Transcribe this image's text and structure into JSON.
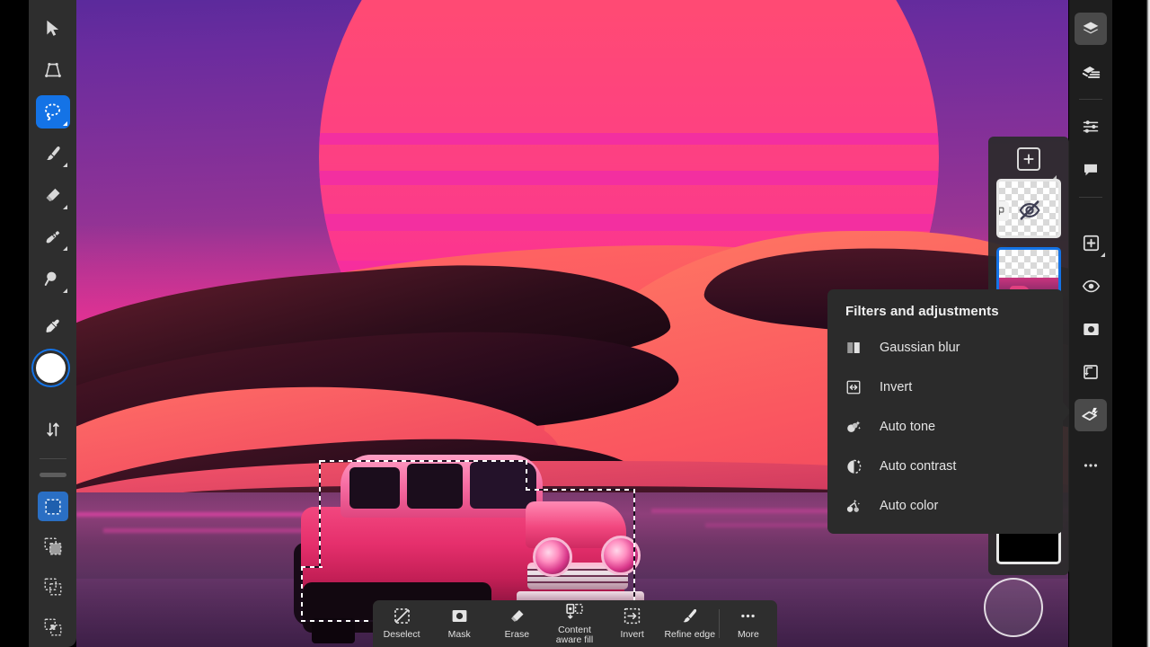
{
  "app": {
    "title": "Photo Editor",
    "accent": "#1473e6",
    "panel_bg": "#2e2e2e"
  },
  "left_toolbar": {
    "tools": [
      {
        "name": "move-tool",
        "label": "Move",
        "icon": "cursor-arrow-icon",
        "active": false,
        "has_flyout": false
      },
      {
        "name": "transform-tool",
        "label": "Transform",
        "icon": "transform-icon",
        "active": false,
        "has_flyout": false
      },
      {
        "name": "lasso-tool",
        "label": "Lasso select",
        "icon": "lasso-icon",
        "active": true,
        "has_flyout": true
      },
      {
        "name": "brush-tool",
        "label": "Brush",
        "icon": "paintbrush-icon",
        "active": false,
        "has_flyout": true
      },
      {
        "name": "eraser-tool",
        "label": "Eraser",
        "icon": "eraser-icon",
        "active": false,
        "has_flyout": true
      },
      {
        "name": "healing-tool",
        "label": "Spot heal",
        "icon": "healing-brush-icon",
        "active": false,
        "has_flyout": true
      },
      {
        "name": "zoom-tool",
        "label": "Zoom",
        "icon": "magnifier-icon",
        "active": false,
        "has_flyout": true
      },
      {
        "name": "eyedropper-tool",
        "label": "Eyedropper",
        "icon": "eyedropper-icon",
        "active": false,
        "has_flyout": false
      }
    ],
    "colors": {
      "foreground": "#ffffff",
      "background": "#000000",
      "swap_label": "Swap colors",
      "swap_icon": "swap-arrows-icon"
    },
    "selection_modes": [
      {
        "name": "new-selection",
        "label": "New selection",
        "icon": "marquee-new-icon",
        "active": true
      },
      {
        "name": "add-to-selection",
        "label": "Add to selection",
        "icon": "marquee-add-icon",
        "active": false
      },
      {
        "name": "subtract-selection",
        "label": "Subtract from selection",
        "icon": "marquee-subtract-icon",
        "active": false
      },
      {
        "name": "intersect-selection",
        "label": "Intersect selection",
        "icon": "marquee-intersect-icon",
        "active": false
      }
    ]
  },
  "right_rail": {
    "items": [
      {
        "name": "layers-panel-button",
        "label": "Layers",
        "icon": "layers-icon",
        "active": true,
        "has_flyout": false
      },
      {
        "name": "layer-stack-button",
        "label": "Layer properties",
        "icon": "layer-stack-icon",
        "active": false,
        "has_flyout": false
      },
      {
        "name": "adjustments-button",
        "label": "Adjustments",
        "icon": "sliders-icon",
        "active": false,
        "has_flyout": false
      },
      {
        "name": "comments-button",
        "label": "Comments",
        "icon": "comment-bubble-icon",
        "active": false,
        "has_flyout": false
      },
      {
        "name": "add-layer-button",
        "label": "Add layer",
        "icon": "add-square-icon",
        "active": false,
        "has_flyout": true
      },
      {
        "name": "visibility-button",
        "label": "Show / hide layer",
        "icon": "eye-icon",
        "active": false,
        "has_flyout": false
      },
      {
        "name": "mask-button",
        "label": "Add mask",
        "icon": "mask-icon",
        "active": false,
        "has_flyout": false
      },
      {
        "name": "clipping-mask-button",
        "label": "Clipping mask",
        "icon": "clipping-mask-icon",
        "active": false,
        "has_flyout": false
      },
      {
        "name": "filters-adjustments-button",
        "label": "Filters and adjustments",
        "icon": "magic-layer-icon",
        "active": true,
        "has_flyout": false
      },
      {
        "name": "more-options-button",
        "label": "More",
        "icon": "ellipsis-icon",
        "active": false,
        "has_flyout": false
      }
    ]
  },
  "layers_panel": {
    "add_layer": {
      "label": "Add layer",
      "icon": "plus-square-icon"
    },
    "layers": [
      {
        "name": "layer-hidden",
        "label": "Hidden layer",
        "selected": false,
        "hidden": true,
        "thumb": "transparent",
        "badge_icon": "link-layers-icon"
      },
      {
        "name": "layer-selected",
        "label": "Selected layer",
        "selected": true,
        "hidden": false,
        "thumb": "artwork",
        "badge_icon": ""
      },
      {
        "name": "layer-black",
        "label": "Black layer",
        "selected": false,
        "hidden": false,
        "thumb": "black",
        "badge_icon": ""
      }
    ]
  },
  "filters_popup": {
    "title": "Filters and adjustments",
    "items": [
      {
        "name": "gaussian-blur-item",
        "label": "Gaussian blur",
        "icon": "blur-halves-icon"
      },
      {
        "name": "invert-item",
        "label": "Invert",
        "icon": "invert-arrows-icon"
      },
      {
        "name": "auto-tone-item",
        "label": "Auto tone",
        "icon": "auto-tone-icon"
      },
      {
        "name": "auto-contrast-item",
        "label": "Auto contrast",
        "icon": "auto-contrast-icon"
      },
      {
        "name": "auto-color-item",
        "label": "Auto color",
        "icon": "auto-color-icon"
      }
    ]
  },
  "bottom_bar": {
    "items": [
      {
        "name": "deselect-button",
        "label": "Deselect",
        "icon": "marquee-dashed-icon"
      },
      {
        "name": "mask-button",
        "label": "Mask",
        "icon": "mask-circle-icon"
      },
      {
        "name": "erase-button",
        "label": "Erase",
        "icon": "eraser-icon"
      },
      {
        "name": "content-fill-button",
        "label": "Content\naware fill",
        "icon": "content-aware-fill-icon"
      },
      {
        "name": "invert-button",
        "label": "Invert",
        "icon": "invert-selection-icon"
      },
      {
        "name": "refine-edge-button",
        "label": "Refine edge",
        "icon": "refine-edge-brush-icon"
      },
      {
        "name": "more-button",
        "label": "More",
        "icon": "ellipsis-icon"
      }
    ]
  },
  "canvas": {
    "name": "artwork-canvas",
    "description": "Synthwave desert scene with retro sun and vintage car",
    "selection_active": true,
    "brush_cursor": {
      "name": "brush-cursor",
      "visible": true
    }
  }
}
